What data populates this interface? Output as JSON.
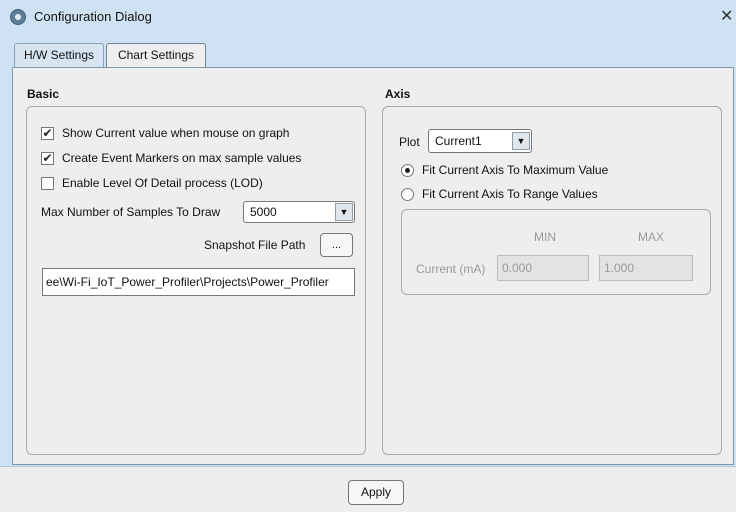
{
  "window": {
    "title": "Configuration Dialog"
  },
  "tabs": [
    {
      "label": "H/W Settings",
      "selected": false
    },
    {
      "label": "Chart Settings",
      "selected": true
    }
  ],
  "basic": {
    "title": "Basic",
    "options": [
      {
        "label": "Show Current value when mouse on graph",
        "checked": true
      },
      {
        "label": "Create Event Markers on max sample values",
        "checked": true
      },
      {
        "label": "Enable Level Of Detail process (LOD)",
        "checked": false
      }
    ],
    "max_samples_label": "Max Number of Samples To Draw",
    "max_samples_value": "5000",
    "snapshot_label": "Snapshot File Path",
    "browse_label": "...",
    "snapshot_path": "ee\\Wi-Fi_IoT_Power_Profiler\\Projects\\Power_Profiler"
  },
  "axis": {
    "title": "Axis",
    "plot_label": "Plot",
    "plot_value": "Current1",
    "radio_options": [
      {
        "label": "Fit Current Axis To Maximum Value",
        "selected": true
      },
      {
        "label": "Fit Current Axis To Range Values",
        "selected": false
      }
    ],
    "range": {
      "min_header": "MIN",
      "max_header": "MAX",
      "row_label": "Current (mA)",
      "min_value": "0.000",
      "max_value": "1.000"
    }
  },
  "footer": {
    "apply_label": "Apply"
  },
  "colors": {
    "titlebar": "#cfe2f3",
    "panel": "#eeeeee",
    "border": "#7f98ac"
  }
}
